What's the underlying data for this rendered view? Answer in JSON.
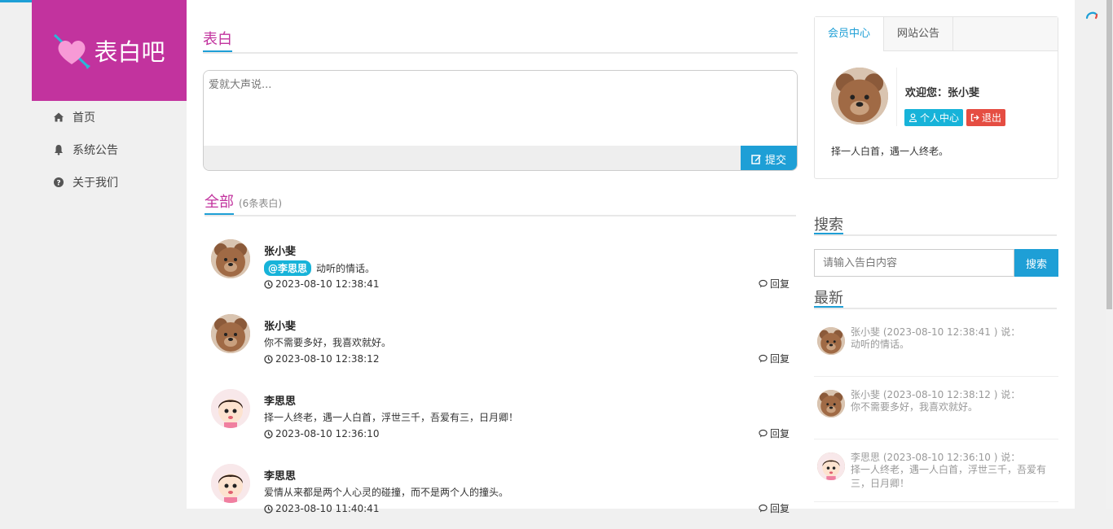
{
  "brand": {
    "name": "表白吧"
  },
  "nav": [
    {
      "label": "首页",
      "icon": "home-icon"
    },
    {
      "label": "系统公告",
      "icon": "bell-icon"
    },
    {
      "label": "关于我们",
      "icon": "question-circle-icon"
    }
  ],
  "compose": {
    "title": "表白",
    "placeholder": "爱就大声说...",
    "submit_label": "提交"
  },
  "feed": {
    "title": "全部",
    "count_label": "(6条表白)",
    "reply_label": "回复",
    "posts": [
      {
        "author": "张小斐",
        "mention": "@李思思",
        "text": "动听的情话。",
        "time": "2023-08-10 12:38:41",
        "avatar": "bear"
      },
      {
        "author": "张小斐",
        "mention": "",
        "text": "你不需要多好，我喜欢就好。",
        "time": "2023-08-10 12:38:12",
        "avatar": "bear"
      },
      {
        "author": "李思思",
        "mention": "",
        "text": "择一人终老，遇一人白首，浮世三千，吾爱有三，日月卿！",
        "time": "2023-08-10 12:36:10",
        "avatar": "girl"
      },
      {
        "author": "李思思",
        "mention": "",
        "text": "爱情从来都是两个人心灵的碰撞，而不是两个人的撞头。",
        "time": "2023-08-10 11:40:41",
        "avatar": "girl"
      }
    ]
  },
  "member": {
    "tabs": [
      "会员中心",
      "网站公告"
    ],
    "welcome": "欢迎您：张小斐",
    "profile_label": "个人中心",
    "logout_label": "退出",
    "motto": "择一人白首，遇一人终老。"
  },
  "search": {
    "title": "搜索",
    "placeholder": "请输入告白内容",
    "button_label": "搜索"
  },
  "latest": {
    "title": "最新",
    "items": [
      {
        "meta": "张小斐 (2023-08-10 12:38:41 ) 说：",
        "text": "动听的情话。",
        "avatar": "bear"
      },
      {
        "meta": "张小斐 (2023-08-10 12:38:12 ) 说：",
        "text": "你不需要多好，我喜欢就好。",
        "avatar": "bear"
      },
      {
        "meta": "李思思 (2023-08-10 12:36:10 ) 说：",
        "text": "择一人终老，遇一人白首，浮世三千，吾爱有三，日月卿！",
        "avatar": "girl"
      }
    ]
  },
  "colors": {
    "brand": "#c2339e",
    "accent": "#1e9fd6",
    "mention": "#17b3d9",
    "danger": "#e54d42"
  }
}
